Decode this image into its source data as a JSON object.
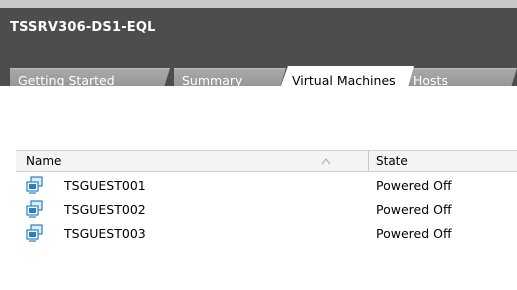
{
  "header": {
    "title": "TSSRV306-DS1-EQL"
  },
  "tabs": [
    {
      "label": "Getting Started"
    },
    {
      "label": "Summary"
    },
    {
      "label": "Virtual Machines"
    },
    {
      "label": "Hosts"
    }
  ],
  "active_tab": "Virtual Machines",
  "table": {
    "columns": [
      "Name",
      "State"
    ],
    "sort": {
      "column": "Name",
      "direction": "ascending"
    },
    "rows": [
      {
        "icon": "virtual-machine-icon",
        "name": "TSGUEST001",
        "state": "Powered Off"
      },
      {
        "icon": "virtual-machine-icon",
        "name": "TSGUEST002",
        "state": "Powered Off"
      },
      {
        "icon": "virtual-machine-icon",
        "name": "TSGUEST003",
        "state": "Powered Off"
      }
    ]
  },
  "colors": {
    "header_bg": "#4d4d4d",
    "tab_bg": "#999999",
    "vm_icon": "#2f7fc1"
  }
}
